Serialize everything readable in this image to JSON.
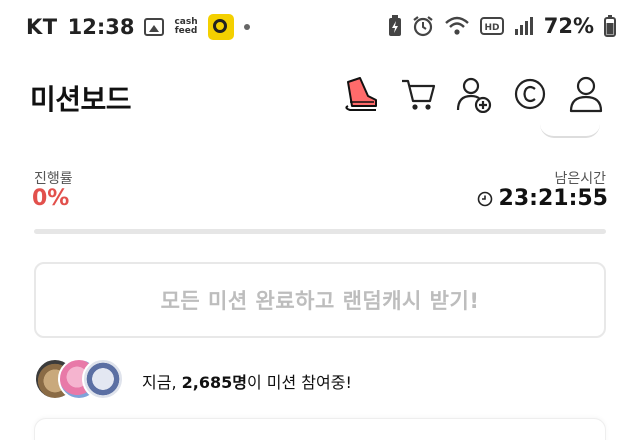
{
  "status_bar": {
    "carrier": "KT",
    "time": "12:38",
    "cashfeed_label": "cash\nfeed",
    "battery": "72%",
    "icons": [
      "image-icon",
      "cashfeed-icon",
      "app-icon",
      "notification-dot",
      "battery-saver-icon",
      "alarm-icon",
      "wifi-icon",
      "hd-icon",
      "signal-icon",
      "battery-icon"
    ]
  },
  "header": {
    "title": "미션보드",
    "icons": [
      "sneaker-icon",
      "cart-icon",
      "add-friend-icon",
      "coin-icon",
      "profile-icon"
    ]
  },
  "progress": {
    "label": "진행률",
    "value": "0%",
    "fraction": 0.0
  },
  "remaining": {
    "label": "남은시간",
    "value": "23:21:55"
  },
  "reward_button": {
    "label": "모든 미션 완료하고 랜덤캐시 받기!"
  },
  "participants": {
    "prefix": "지금, ",
    "count": "2,685명",
    "suffix": "이 미션 참여중!"
  },
  "colors": {
    "accent": "#e2504c",
    "disabled_text": "#bdbdbd",
    "border": "#e8e8e8"
  }
}
